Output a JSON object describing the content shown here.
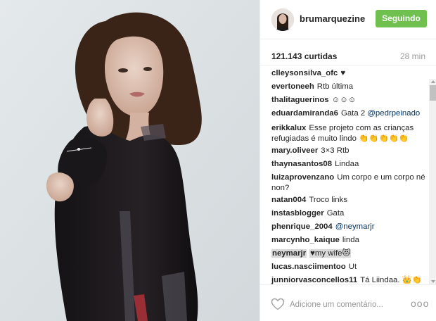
{
  "post": {
    "username": "brumarquezine",
    "follow_label": "Seguindo",
    "likes": "121.143 curtidas",
    "time": "28 min"
  },
  "comments": [
    {
      "user": "clleysonsilva_ofc",
      "text": "♥"
    },
    {
      "user": "evertoneeh",
      "text": "Rtb última"
    },
    {
      "user": "thalitaguerinos",
      "text": "☺☺☺"
    },
    {
      "user": "eduardamiranda6",
      "text": "Gata 2",
      "mention": "@pedrpeinado"
    },
    {
      "user": "erikkalux",
      "text": "Esse projeto com as crianças refugiadas é muito lindo 👏👏👏👏👏"
    },
    {
      "user": "mary.oliveer",
      "text": "3×3 Rtb"
    },
    {
      "user": "thaynasantos08",
      "text": "Lindaa"
    },
    {
      "user": "luizaprovenzano",
      "text": "Um corpo e um corpo né non?"
    },
    {
      "user": "natan004",
      "text": "Troco links"
    },
    {
      "user": "instasblogger",
      "text": "Gata"
    },
    {
      "user": "phenrique_2004",
      "text": "",
      "mention": "@neymarjr"
    },
    {
      "user": "marcynho_kaique",
      "text": "linda"
    },
    {
      "user": "neymarjr",
      "text": "♥my wife😻"
    },
    {
      "user": "lucas.nasciimentoo",
      "text": "Ut"
    },
    {
      "user": "junniorvasconcellos11",
      "text": "Tá Liindaa. 👑👏☺"
    }
  ],
  "footer": {
    "comment_placeholder": "Adicione um comentário...",
    "more_label": "ooo"
  },
  "colors": {
    "follow_button": "#70c050",
    "mention": "#003569",
    "highlight": "#d9d9d9"
  },
  "icons": [
    "heart-icon",
    "more-options-icon",
    "avatar"
  ]
}
